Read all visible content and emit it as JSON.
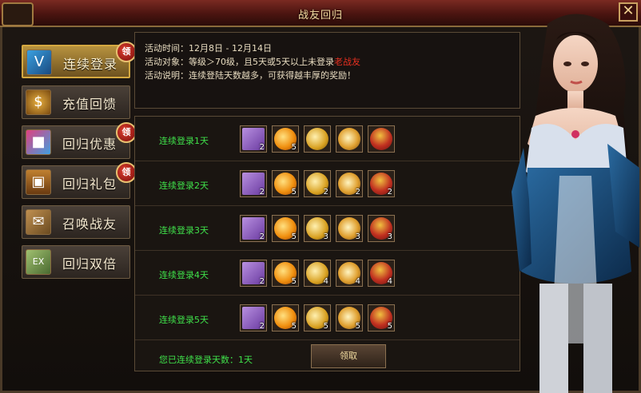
{
  "window": {
    "title": "战友回归",
    "close_label": "✕"
  },
  "sidebar": {
    "items": [
      {
        "label": "连续登录",
        "icon": "vip-card-icon",
        "badge": "领",
        "active": true
      },
      {
        "label": "充值回馈",
        "icon": "money-bag-icon",
        "badge": null,
        "active": false
      },
      {
        "label": "回归优惠",
        "icon": "gift-boxes-icon",
        "badge": "领",
        "active": false
      },
      {
        "label": "回归礼包",
        "icon": "treasure-chest-icon",
        "badge": "领",
        "active": false
      },
      {
        "label": "召唤战友",
        "icon": "scroll-icon",
        "badge": null,
        "active": false
      },
      {
        "label": "回归双倍",
        "icon": "exp-scroll-icon",
        "badge": null,
        "active": false
      }
    ]
  },
  "info": {
    "line1": "活动时间：12月8日 - 12月14日",
    "line2_prefix": "活动对象：等级＞70级，且5天或5天以上未登录",
    "line2_highlight": "老战友",
    "line3": "活动说明：连续登陆天数越多，可获得越丰厚的奖励！"
  },
  "rewards": {
    "rows": [
      {
        "label": "连续登录1天",
        "counts": [
          "2",
          "5",
          "",
          "",
          ""
        ]
      },
      {
        "label": "连续登录2天",
        "counts": [
          "2",
          "5",
          "2",
          "2",
          "2"
        ]
      },
      {
        "label": "连续登录3天",
        "counts": [
          "2",
          "5",
          "3",
          "3",
          "3"
        ]
      },
      {
        "label": "连续登录4天",
        "counts": [
          "2",
          "5",
          "4",
          "4",
          "4"
        ]
      },
      {
        "label": "连续登录5天",
        "counts": [
          "2",
          "5",
          "5",
          "5",
          "5"
        ]
      }
    ],
    "item_icons": [
      "skill-book-icon",
      "gold-coin-icon",
      "golden-orb-icon",
      "flame-orb-icon",
      "potion-pot-icon"
    ],
    "status_text": "您已连续登录天数：1天",
    "claim_label": "领取"
  },
  "colors": {
    "accent_green": "#3fe04a",
    "highlight_red": "#e83020",
    "title_gold": "#f2dca0"
  }
}
